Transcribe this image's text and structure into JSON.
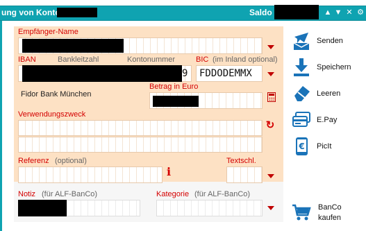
{
  "window": {
    "title": "ung von Konto",
    "saldo_label": "Saldo",
    "controls": {
      "up": "▲",
      "down": "▼",
      "close": "✕",
      "settings": "⚙"
    }
  },
  "form": {
    "recipient": {
      "label": "Empfänger-Name",
      "value": ""
    },
    "iban": {
      "label_iban": "IBAN",
      "label_blz": "Bankleitzahl",
      "label_account": "Kontonummer",
      "value_tail": "9"
    },
    "bic": {
      "label": "BIC",
      "hint": "(im Inland optional)",
      "value": "FDDODEMMX"
    },
    "bank_name": "Fidor Bank München",
    "amount": {
      "label": "Betrag in Euro"
    },
    "purpose": {
      "label": "Verwendungszweck"
    },
    "reference": {
      "label": "Referenz",
      "hint": "(optional)"
    },
    "textkey": {
      "label": "Textschl."
    },
    "note": {
      "label": "Notiz",
      "hint": "(für ALF-BanCo)"
    },
    "category": {
      "label": "Kategorie",
      "hint": "(für ALF-BanCo)"
    }
  },
  "actions": [
    {
      "id": "send",
      "label": "Senden",
      "icon": "send-mail-icon"
    },
    {
      "id": "save",
      "label": "Speichern",
      "icon": "download-icon"
    },
    {
      "id": "clear",
      "label": "Leeren",
      "icon": "eraser-icon"
    },
    {
      "id": "epay",
      "label": "E.Pay",
      "icon": "card-icon"
    },
    {
      "id": "picit",
      "label": "PicIt",
      "icon": "phone-euro-icon"
    }
  ],
  "banco": {
    "line1": "BanCo",
    "line2": "kaufen",
    "icon": "cart-icon"
  },
  "colors": {
    "accent": "#0fa3b1",
    "form_bg": "#fde1c4",
    "required_label": "#d40000",
    "icon_blue": "#1a73b8"
  }
}
